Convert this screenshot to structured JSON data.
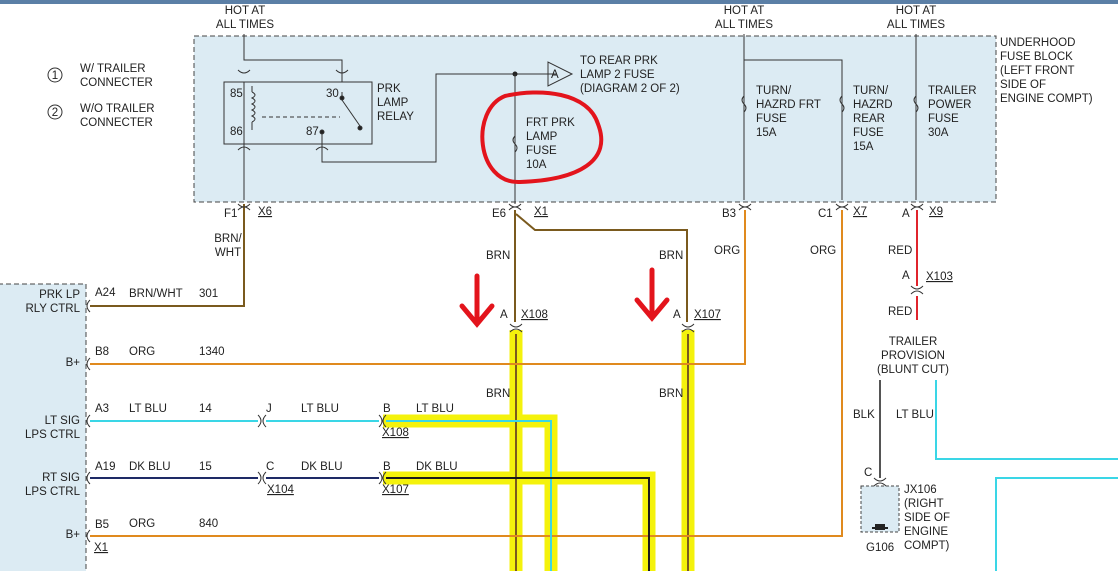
{
  "colors": {
    "brown": "#7a5a1e",
    "orange": "#e08a1e",
    "light_blue": "#3ad6e6",
    "dark_blue": "#1e2a66",
    "red": "#e0242c",
    "black": "#1a1a1a",
    "gray": "#555555",
    "highlight": "#f4f20c",
    "fuse_block_fill": "#dcebf3",
    "marker_red": "#e3141c"
  },
  "legend": {
    "item1_number": "1",
    "item1_text": "W/ TRAILER\nCONNECTER",
    "item2_number": "2",
    "item2_text": "W/O TRAILER\nCONNECTER"
  },
  "power": {
    "hot1": "HOT AT\nALL TIMES",
    "hot2": "HOT AT\nALL TIMES",
    "hot3": "HOT AT\nALL TIMES"
  },
  "fuse_block": {
    "label": "UNDERHOOD\nFUSE BLOCK\n(LEFT FRONT\nSIDE OF\nENGINE COMPT)",
    "relay_label": "PRK\nLAMP\nRELAY",
    "pin_85": "85",
    "pin_86": "86",
    "pin_30": "30",
    "pin_87": "87",
    "arrow_letter": "A",
    "to_rear": "TO REAR PRK\nLAMP 2 FUSE\n(DIAGRAM 2 OF 2)",
    "frt_fuse": "FRT PRK\nLAMP\nFUSE\n10A",
    "turn_frt": "TURN/\nHAZRD FRT\nFUSE\n15A",
    "turn_rear": "TURN/\nHAZRD\nREAR\nFUSE\n15A",
    "trailer_fuse": "TRAILER\nPOWER\nFUSE\n30A"
  },
  "connectors": {
    "f1": "F1",
    "x6": "X6",
    "e6": "E6",
    "x1_top": "X1",
    "b3": "B3",
    "c1": "C1",
    "x7": "X7",
    "a_x9": "A",
    "x9": "X9",
    "a_x103": "A",
    "x103": "X103",
    "a_x108": "A",
    "x108_top": "X108",
    "a_x107": "A",
    "x107_top": "X107",
    "j": "J",
    "c_x104": "C",
    "x104": "X104",
    "b_x108": "B",
    "x108_low": "X108",
    "b_x107": "B",
    "x107_low": "X107",
    "x1_left": "X1",
    "jx106_c": "C"
  },
  "wires": {
    "brn_wht_vertical": "BRN/\nWHT",
    "brn_e6": "BRN",
    "brn_right": "BRN",
    "org_b3": "ORG",
    "org_c1": "ORG",
    "red_upper": "RED",
    "red_lower": "RED",
    "brn_lower_left": "BRN",
    "brn_lower_right": "BRN",
    "blk": "BLK",
    "lt_blu_right": "LT BLU"
  },
  "module_pins": [
    {
      "name": "PRK LP\nRLY CTRL",
      "pin": "A24",
      "color_text": "BRN/WHT",
      "circuit": "301"
    },
    {
      "name": "B+",
      "pin": "B8",
      "color_text": "ORG",
      "circuit": "1340"
    },
    {
      "name": "LT SIG\nLPS CTRL",
      "pin": "A3",
      "color_text": "LT BLU",
      "circuit": "14",
      "after_text": "LT BLU",
      "after_text2": "LT BLU"
    },
    {
      "name": "RT SIG\nLPS CTRL",
      "pin": "A19",
      "color_text": "DK BLU",
      "circuit": "15",
      "after_text": "DK BLU",
      "after_text2": "DK BLU"
    },
    {
      "name": "B+",
      "pin": "B5",
      "color_text": "ORG",
      "circuit": "840"
    }
  ],
  "trailer": {
    "provision": "TRAILER\nPROVISION\n(BLUNT CUT)",
    "jx106": "JX106\n(RIGHT\nSIDE OF\nENGINE\nCOMPT)",
    "ground": "G106"
  }
}
